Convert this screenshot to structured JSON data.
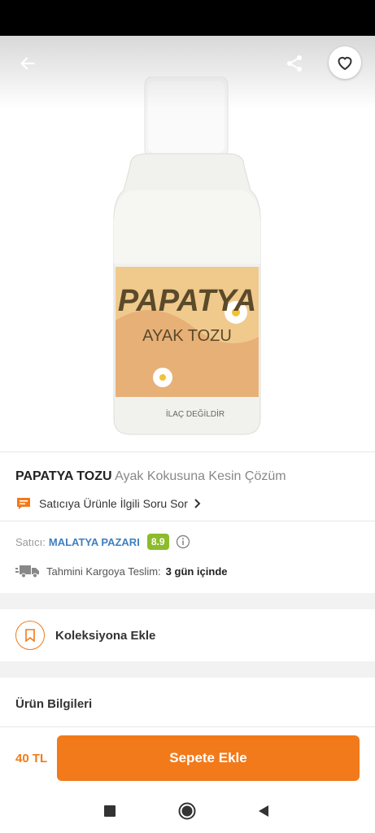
{
  "product": {
    "brand": "PAPATYA TOZU",
    "description": "Ayak Kokusuna Kesin Çözüm",
    "label_line1": "PAPATYA",
    "label_line2": "AYAK TOZU",
    "label_line3": "İLAÇ DEĞİLDİR"
  },
  "ask_seller": {
    "label": "Satıcıya Ürünle İlgili Soru Sor"
  },
  "seller": {
    "label": "Satıcı:",
    "name": "MALATYA PAZARI",
    "rating": "8.9"
  },
  "shipping": {
    "label": "Tahmini Kargoya Teslim:",
    "value": "3 gün içinde"
  },
  "collection": {
    "label": "Koleksiyona Ekle"
  },
  "product_info": {
    "title": "Ürün Bilgileri"
  },
  "bottom_bar": {
    "price": "40 TL",
    "cart_button": "Sepete Ekle"
  },
  "icons": {
    "back": "arrow-left-icon",
    "share": "share-icon",
    "favorite": "heart-icon",
    "chat": "chat-icon",
    "chevron": "chevron-right-icon",
    "info": "info-icon",
    "truck": "truck-icon",
    "bookmark": "bookmark-icon",
    "nav_recent": "square-icon",
    "nav_home": "circle-icon",
    "nav_back": "triangle-back-icon"
  },
  "colors": {
    "accent": "#f27a1a",
    "seller_link": "#3f7fc0",
    "rating_badge": "#8cbc2b"
  }
}
